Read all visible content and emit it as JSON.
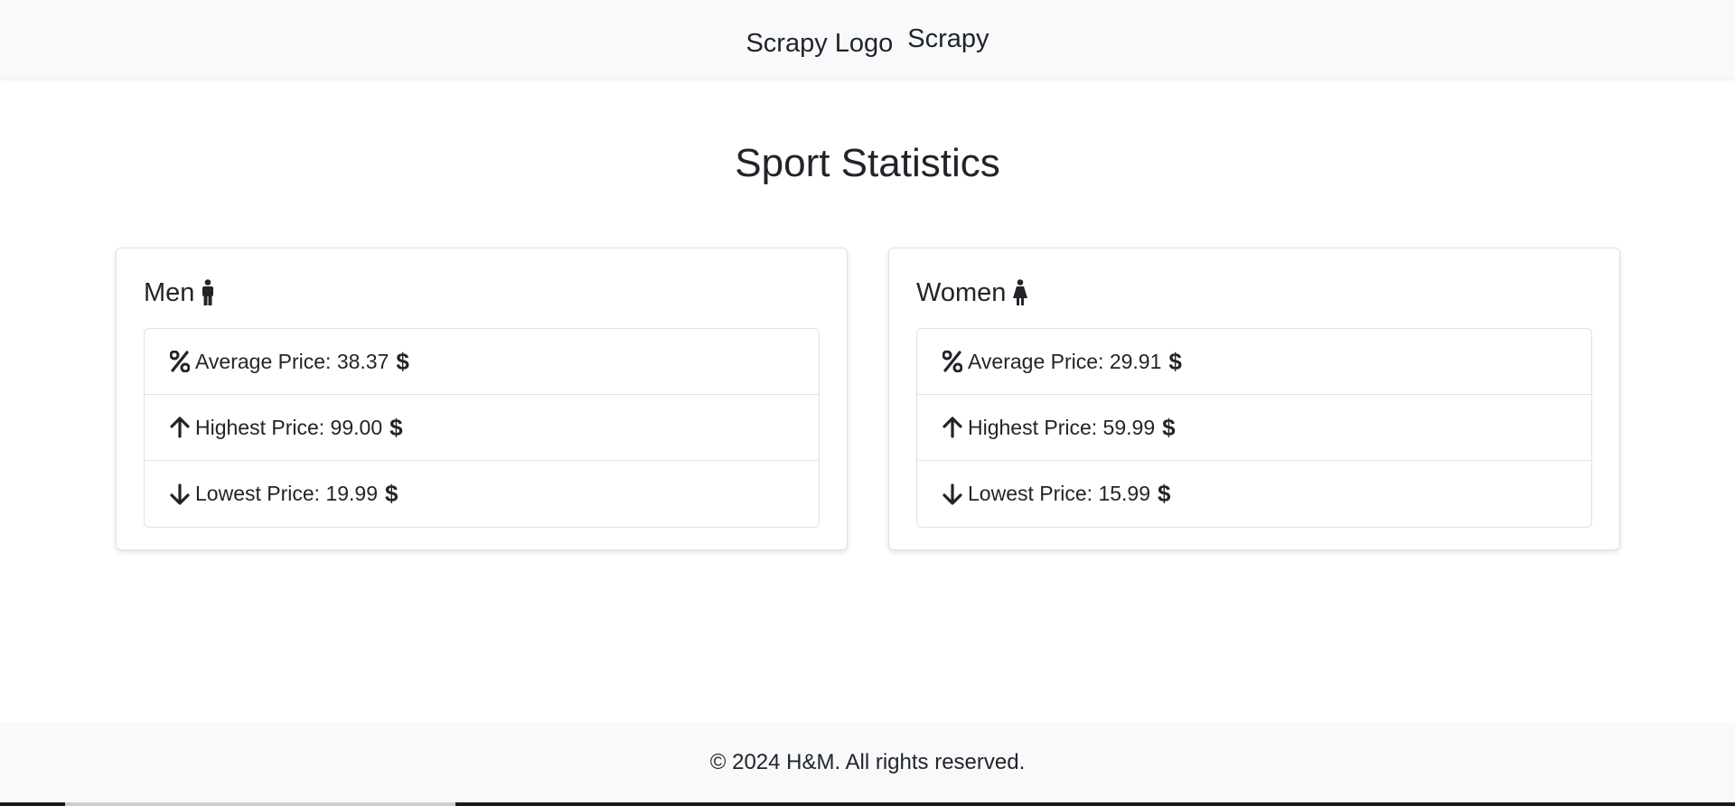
{
  "navbar": {
    "logo_alt": "Scrapy Logo",
    "brand": "Scrapy"
  },
  "page": {
    "title": "Sport Statistics"
  },
  "cards": {
    "men": {
      "title": "Men",
      "icon": "male-icon",
      "average": "Average Price: 38.37",
      "highest": "Highest Price: 99.00",
      "lowest": "Lowest Price: 19.99"
    },
    "women": {
      "title": "Women",
      "icon": "female-icon",
      "average": "Average Price: 29.91",
      "highest": "Highest Price: 59.99",
      "lowest": "Lowest Price: 15.99"
    },
    "currency_symbol": "$"
  },
  "footer": {
    "text": "© 2024 H&M. All rights reserved."
  },
  "colors": {
    "navbar_bg": "#f8f9fa",
    "text": "#212529",
    "border": "#dee2e6"
  }
}
